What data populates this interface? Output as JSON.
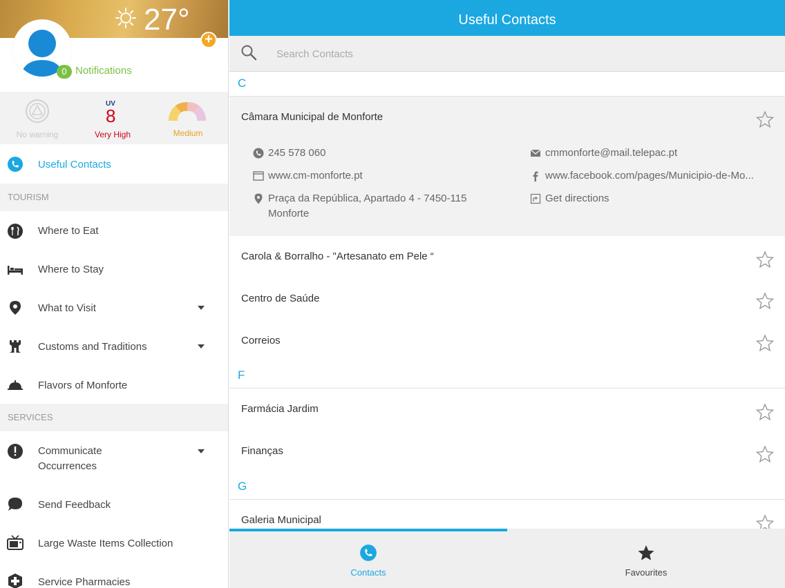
{
  "weather": {
    "temperature": "27°",
    "icon": "sun-icon"
  },
  "profile": {
    "notification_count": "0",
    "notifications_label": "Notifications"
  },
  "status": {
    "warning_label": "No warning",
    "uv_label": "UV",
    "uv_value": "8",
    "uv_level": "Very High",
    "gauge_label": "Medium"
  },
  "sidebar": {
    "active_item": "Useful Contacts",
    "sections": {
      "tourism": "TOURISM",
      "services": "SERVICES"
    },
    "tourism_items": [
      "Where to Eat",
      "Where to Stay",
      "What to Visit",
      "Customs and Traditions",
      "Flavors of Monforte"
    ],
    "communicate_line1": "Communicate",
    "communicate_line2": "Occurrences",
    "service_items": [
      "Send Feedback",
      "Large Waste Items Collection",
      "Service Pharmacies"
    ]
  },
  "main": {
    "title": "Useful Contacts",
    "search_placeholder": "Search Contacts",
    "letters": [
      "C",
      "F",
      "G"
    ],
    "expanded_contact": {
      "name": "Câmara Municipal de Monforte",
      "phone": "245 578 060",
      "email": "cmmonforte@mail.telepac.pt",
      "website": "www.cm-monforte.pt",
      "facebook": "www.facebook.com/pages/Municipio-de-Mo...",
      "address_line1": "Praça da República, Apartado 4 - 7450-115",
      "address_line2": "Monforte",
      "directions": "Get directions"
    },
    "contacts": [
      "Carola & Borralho - \"Artesanato em Pele “",
      "Centro de Saúde",
      "Correios",
      "Farmácia Jardim",
      "Finanças",
      "Galeria Municipal"
    ]
  },
  "tabs": {
    "contacts": "Contacts",
    "favourites": "Favourites"
  },
  "colors": {
    "accent": "#1ba8e0",
    "green": "#7ac143",
    "red": "#d0021b",
    "orange": "#f5a623"
  }
}
